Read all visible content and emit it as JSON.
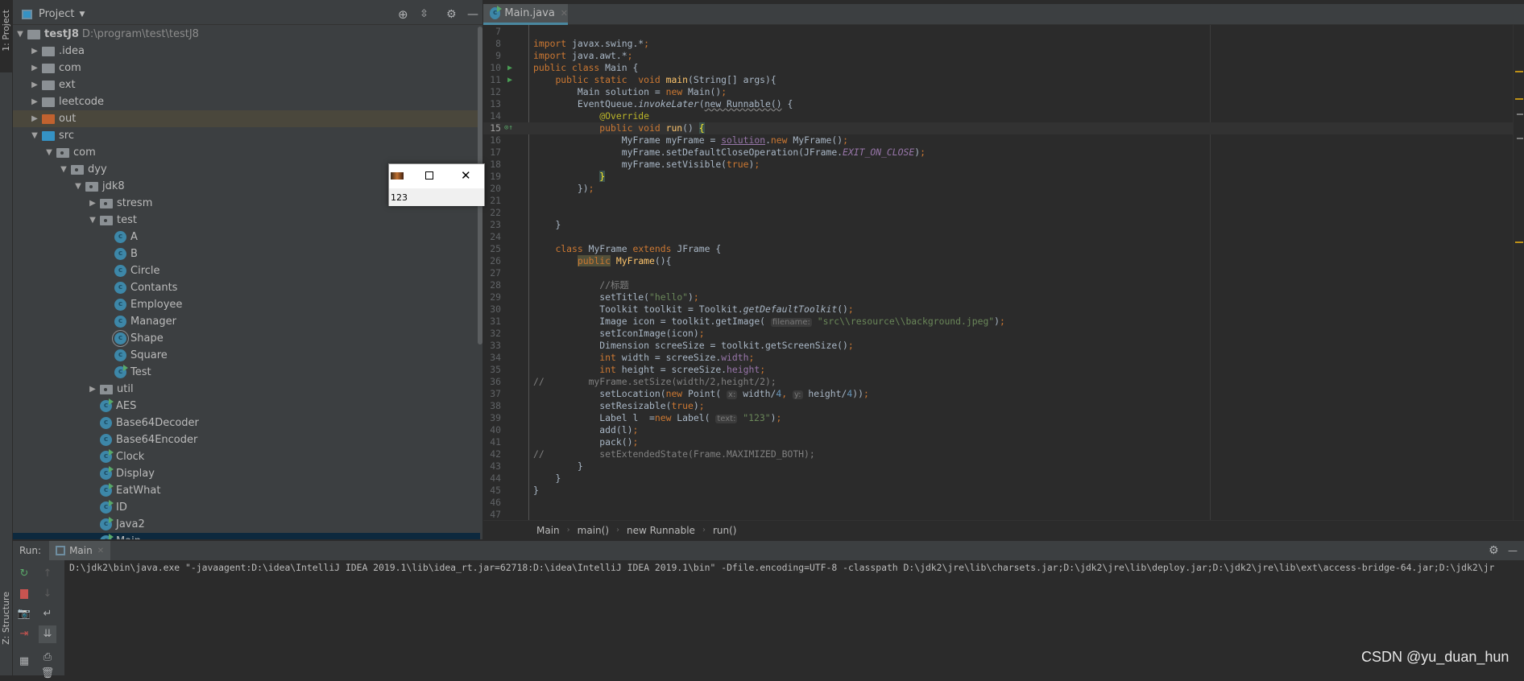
{
  "side_stripe": {
    "project_label": "1: Project",
    "structure_label": "Z: Structure"
  },
  "project_panel": {
    "title": "Project",
    "tree": [
      {
        "label": "testJ8",
        "path": "D:\\program\\test\\testJ8",
        "level": 0,
        "type": "module",
        "expanded": true
      },
      {
        "label": ".idea",
        "level": 1,
        "type": "folder",
        "expanded": false
      },
      {
        "label": "com",
        "level": 1,
        "type": "folder",
        "expanded": false
      },
      {
        "label": "ext",
        "level": 1,
        "type": "folder",
        "expanded": false
      },
      {
        "label": "leetcode",
        "level": 1,
        "type": "folder",
        "expanded": false
      },
      {
        "label": "out",
        "level": 1,
        "type": "folder-orange",
        "expanded": false,
        "highlighted": true
      },
      {
        "label": "src",
        "level": 1,
        "type": "folder-blue",
        "expanded": true
      },
      {
        "label": "com",
        "level": 2,
        "type": "package",
        "expanded": true
      },
      {
        "label": "dyy",
        "level": 3,
        "type": "package",
        "expanded": true
      },
      {
        "label": "jdk8",
        "level": 4,
        "type": "package",
        "expanded": true
      },
      {
        "label": "stresm",
        "level": 5,
        "type": "package",
        "expanded": false
      },
      {
        "label": "test",
        "level": 5,
        "type": "package",
        "expanded": true
      },
      {
        "label": "A",
        "level": 6,
        "type": "class"
      },
      {
        "label": "B",
        "level": 6,
        "type": "class"
      },
      {
        "label": "Circle",
        "level": 6,
        "type": "class"
      },
      {
        "label": "Contants",
        "level": 6,
        "type": "class"
      },
      {
        "label": "Employee",
        "level": 6,
        "type": "class"
      },
      {
        "label": "Manager",
        "level": 6,
        "type": "class"
      },
      {
        "label": "Shape",
        "level": 6,
        "type": "abstract-class"
      },
      {
        "label": "Square",
        "level": 6,
        "type": "class"
      },
      {
        "label": "Test",
        "level": 6,
        "type": "runnable-class"
      },
      {
        "label": "util",
        "level": 5,
        "type": "package",
        "expanded": false
      },
      {
        "label": "AES",
        "level": 5,
        "type": "runnable-class"
      },
      {
        "label": "Base64Decoder",
        "level": 5,
        "type": "class"
      },
      {
        "label": "Base64Encoder",
        "level": 5,
        "type": "class"
      },
      {
        "label": "Clock",
        "level": 5,
        "type": "runnable-class"
      },
      {
        "label": "Display",
        "level": 5,
        "type": "runnable-class"
      },
      {
        "label": "EatWhat",
        "level": 5,
        "type": "runnable-class"
      },
      {
        "label": "ID",
        "level": 5,
        "type": "runnable-class"
      },
      {
        "label": "Java2",
        "level": 5,
        "type": "runnable-class"
      },
      {
        "label": "Main",
        "level": 5,
        "type": "runnable-class",
        "selected": true
      }
    ]
  },
  "editor": {
    "tab": {
      "label": "Main.java"
    },
    "current_line": 15,
    "lines": [
      {
        "n": 7,
        "indent": 0,
        "t": []
      },
      {
        "n": 8,
        "indent": 0,
        "t": [
          [
            "k",
            "import"
          ],
          [
            "t",
            " javax.swing.*"
          ],
          [
            "k",
            ";"
          ]
        ]
      },
      {
        "n": 9,
        "indent": 0,
        "t": [
          [
            "k",
            "import"
          ],
          [
            "t",
            " java.awt.*"
          ],
          [
            "k",
            ";"
          ]
        ]
      },
      {
        "n": 10,
        "indent": 0,
        "run": true,
        "t": [
          [
            "k",
            "public class"
          ],
          [
            "t",
            " Main {"
          ]
        ]
      },
      {
        "n": 11,
        "indent": 4,
        "run": true,
        "t": [
          [
            "k",
            "public static  void "
          ],
          [
            "m",
            "main"
          ],
          [
            "t",
            "(String[] args){"
          ]
        ]
      },
      {
        "n": 12,
        "indent": 8,
        "t": [
          [
            "t",
            "Main solution = "
          ],
          [
            "k",
            "new"
          ],
          [
            "t",
            " Main()"
          ],
          [
            "k",
            ";"
          ]
        ]
      },
      {
        "n": 13,
        "indent": 8,
        "t": [
          [
            "t",
            "EventQueue."
          ],
          [
            "i",
            "invokeLater"
          ],
          [
            "t",
            "("
          ],
          [
            "w",
            "new Runnable()"
          ],
          [
            "t",
            " {"
          ]
        ]
      },
      {
        "n": 14,
        "indent": 12,
        "t": [
          [
            "a",
            "@Override"
          ]
        ]
      },
      {
        "n": 15,
        "indent": 12,
        "override": true,
        "t": [
          [
            "k",
            "public void "
          ],
          [
            "m",
            "run"
          ],
          [
            "t",
            "() "
          ],
          [
            "b",
            "{"
          ]
        ]
      },
      {
        "n": 16,
        "indent": 16,
        "t": [
          [
            "t",
            "MyFrame myFrame = "
          ],
          [
            "u",
            "solution"
          ],
          [
            "t",
            "."
          ],
          [
            "k",
            "new"
          ],
          [
            "t",
            " MyFrame()"
          ],
          [
            "k",
            ";"
          ]
        ]
      },
      {
        "n": 17,
        "indent": 16,
        "t": [
          [
            "t",
            "myFrame.setDefaultCloseOperation(JFrame."
          ],
          [
            "fi",
            "EXIT_ON_CLOSE"
          ],
          [
            "t",
            ")"
          ],
          [
            "k",
            ";"
          ]
        ]
      },
      {
        "n": 18,
        "indent": 16,
        "t": [
          [
            "t",
            "myFrame.setVisible("
          ],
          [
            "k",
            "true"
          ],
          [
            "t",
            ")"
          ],
          [
            "k",
            ";"
          ]
        ]
      },
      {
        "n": 19,
        "indent": 12,
        "t": [
          [
            "b",
            "}"
          ]
        ]
      },
      {
        "n": 20,
        "indent": 8,
        "t": [
          [
            "t",
            "})"
          ],
          [
            "k",
            ";"
          ]
        ]
      },
      {
        "n": 21,
        "indent": 0,
        "t": []
      },
      {
        "n": 22,
        "indent": 0,
        "t": []
      },
      {
        "n": 23,
        "indent": 4,
        "t": [
          [
            "t",
            "}"
          ]
        ]
      },
      {
        "n": 24,
        "indent": 0,
        "t": []
      },
      {
        "n": 25,
        "indent": 4,
        "t": [
          [
            "k",
            "class"
          ],
          [
            "t",
            " MyFrame "
          ],
          [
            "k",
            "extends"
          ],
          [
            "t",
            " JFrame {"
          ]
        ]
      },
      {
        "n": 26,
        "indent": 8,
        "t": [
          [
            "kh",
            "public"
          ],
          [
            "m",
            " MyFrame"
          ],
          [
            "t",
            "(){"
          ]
        ]
      },
      {
        "n": 27,
        "indent": 0,
        "t": []
      },
      {
        "n": 28,
        "indent": 12,
        "t": [
          [
            "c",
            "//标题"
          ]
        ]
      },
      {
        "n": 29,
        "indent": 12,
        "t": [
          [
            "t",
            "setTitle("
          ],
          [
            "s",
            "\"hello\""
          ],
          [
            "t",
            ")"
          ],
          [
            "k",
            ";"
          ]
        ]
      },
      {
        "n": 30,
        "indent": 12,
        "t": [
          [
            "t",
            "Toolkit toolkit = Toolkit."
          ],
          [
            "i",
            "getDefaultToolkit"
          ],
          [
            "t",
            "()"
          ],
          [
            "k",
            ";"
          ]
        ]
      },
      {
        "n": 31,
        "indent": 12,
        "t": [
          [
            "t",
            "Image icon = toolkit.getImage( "
          ],
          [
            "h",
            "filename:"
          ],
          [
            "s",
            " \"src\\\\resource\\\\background.jpeg\""
          ],
          [
            "t",
            ")"
          ],
          [
            "k",
            ";"
          ]
        ]
      },
      {
        "n": 32,
        "indent": 12,
        "t": [
          [
            "t",
            "setIconImage(icon)"
          ],
          [
            "k",
            ";"
          ]
        ]
      },
      {
        "n": 33,
        "indent": 12,
        "t": [
          [
            "t",
            "Dimension screeSize = toolkit.getScreenSize()"
          ],
          [
            "k",
            ";"
          ]
        ]
      },
      {
        "n": 34,
        "indent": 12,
        "t": [
          [
            "k",
            "int"
          ],
          [
            "t",
            " width = screeSize."
          ],
          [
            "f",
            "width"
          ],
          [
            "k",
            ";"
          ]
        ]
      },
      {
        "n": 35,
        "indent": 12,
        "t": [
          [
            "k",
            "int"
          ],
          [
            "t",
            " height = screeSize."
          ],
          [
            "f",
            "height"
          ],
          [
            "k",
            ";"
          ]
        ]
      },
      {
        "n": 36,
        "indent": 0,
        "t": [
          [
            "c",
            "//        myFrame.setSize(width/2,height/2);"
          ]
        ]
      },
      {
        "n": 37,
        "indent": 12,
        "t": [
          [
            "t",
            "setLocation("
          ],
          [
            "k",
            "new"
          ],
          [
            "t",
            " Point( "
          ],
          [
            "h",
            "x:"
          ],
          [
            "t",
            " width/"
          ],
          [
            "n",
            "4"
          ],
          [
            "k",
            ","
          ],
          [
            "t",
            " "
          ],
          [
            "h",
            "y:"
          ],
          [
            "t",
            " height/"
          ],
          [
            "n",
            "4"
          ],
          [
            "t",
            "))"
          ],
          [
            "k",
            ";"
          ]
        ]
      },
      {
        "n": 38,
        "indent": 12,
        "t": [
          [
            "t",
            "setResizable("
          ],
          [
            "k",
            "true"
          ],
          [
            "t",
            ")"
          ],
          [
            "k",
            ";"
          ]
        ]
      },
      {
        "n": 39,
        "indent": 12,
        "t": [
          [
            "t",
            "Label l  ="
          ],
          [
            "k",
            "new"
          ],
          [
            "t",
            " Label( "
          ],
          [
            "h",
            "text:"
          ],
          [
            "s",
            " \"123\""
          ],
          [
            "t",
            ")"
          ],
          [
            "k",
            ";"
          ]
        ]
      },
      {
        "n": 40,
        "indent": 12,
        "t": [
          [
            "t",
            "add(l)"
          ],
          [
            "k",
            ";"
          ]
        ]
      },
      {
        "n": 41,
        "indent": 12,
        "t": [
          [
            "t",
            "pack()"
          ],
          [
            "k",
            ";"
          ]
        ]
      },
      {
        "n": 42,
        "indent": 0,
        "t": [
          [
            "c",
            "//          setExtendedState(Frame.MAXIMIZED_BOTH);"
          ]
        ]
      },
      {
        "n": 43,
        "indent": 8,
        "t": [
          [
            "t",
            "}"
          ]
        ]
      },
      {
        "n": 44,
        "indent": 4,
        "t": [
          [
            "t",
            "}"
          ]
        ]
      },
      {
        "n": 45,
        "indent": 0,
        "t": [
          [
            "t",
            "}"
          ]
        ]
      },
      {
        "n": 46,
        "indent": 0,
        "t": []
      },
      {
        "n": 47,
        "indent": 0,
        "t": []
      }
    ],
    "breadcrumb": [
      "Main",
      "main()",
      "new Runnable",
      "run()"
    ]
  },
  "run_panel": {
    "label": "Run:",
    "tab": "Main",
    "console": "D:\\jdk2\\bin\\java.exe \"-javaagent:D:\\idea\\IntelliJ IDEA 2019.1\\lib\\idea_rt.jar=62718:D:\\idea\\IntelliJ IDEA 2019.1\\bin\" -Dfile.encoding=UTF-8 -classpath D:\\jdk2\\jre\\lib\\charsets.jar;D:\\jdk2\\jre\\lib\\deploy.jar;D:\\jdk2\\jre\\lib\\ext\\access-bridge-64.jar;D:\\jdk2\\jr"
  },
  "popup_window": {
    "label_text": "123"
  },
  "watermark": "CSDN @yu_duan_hun"
}
